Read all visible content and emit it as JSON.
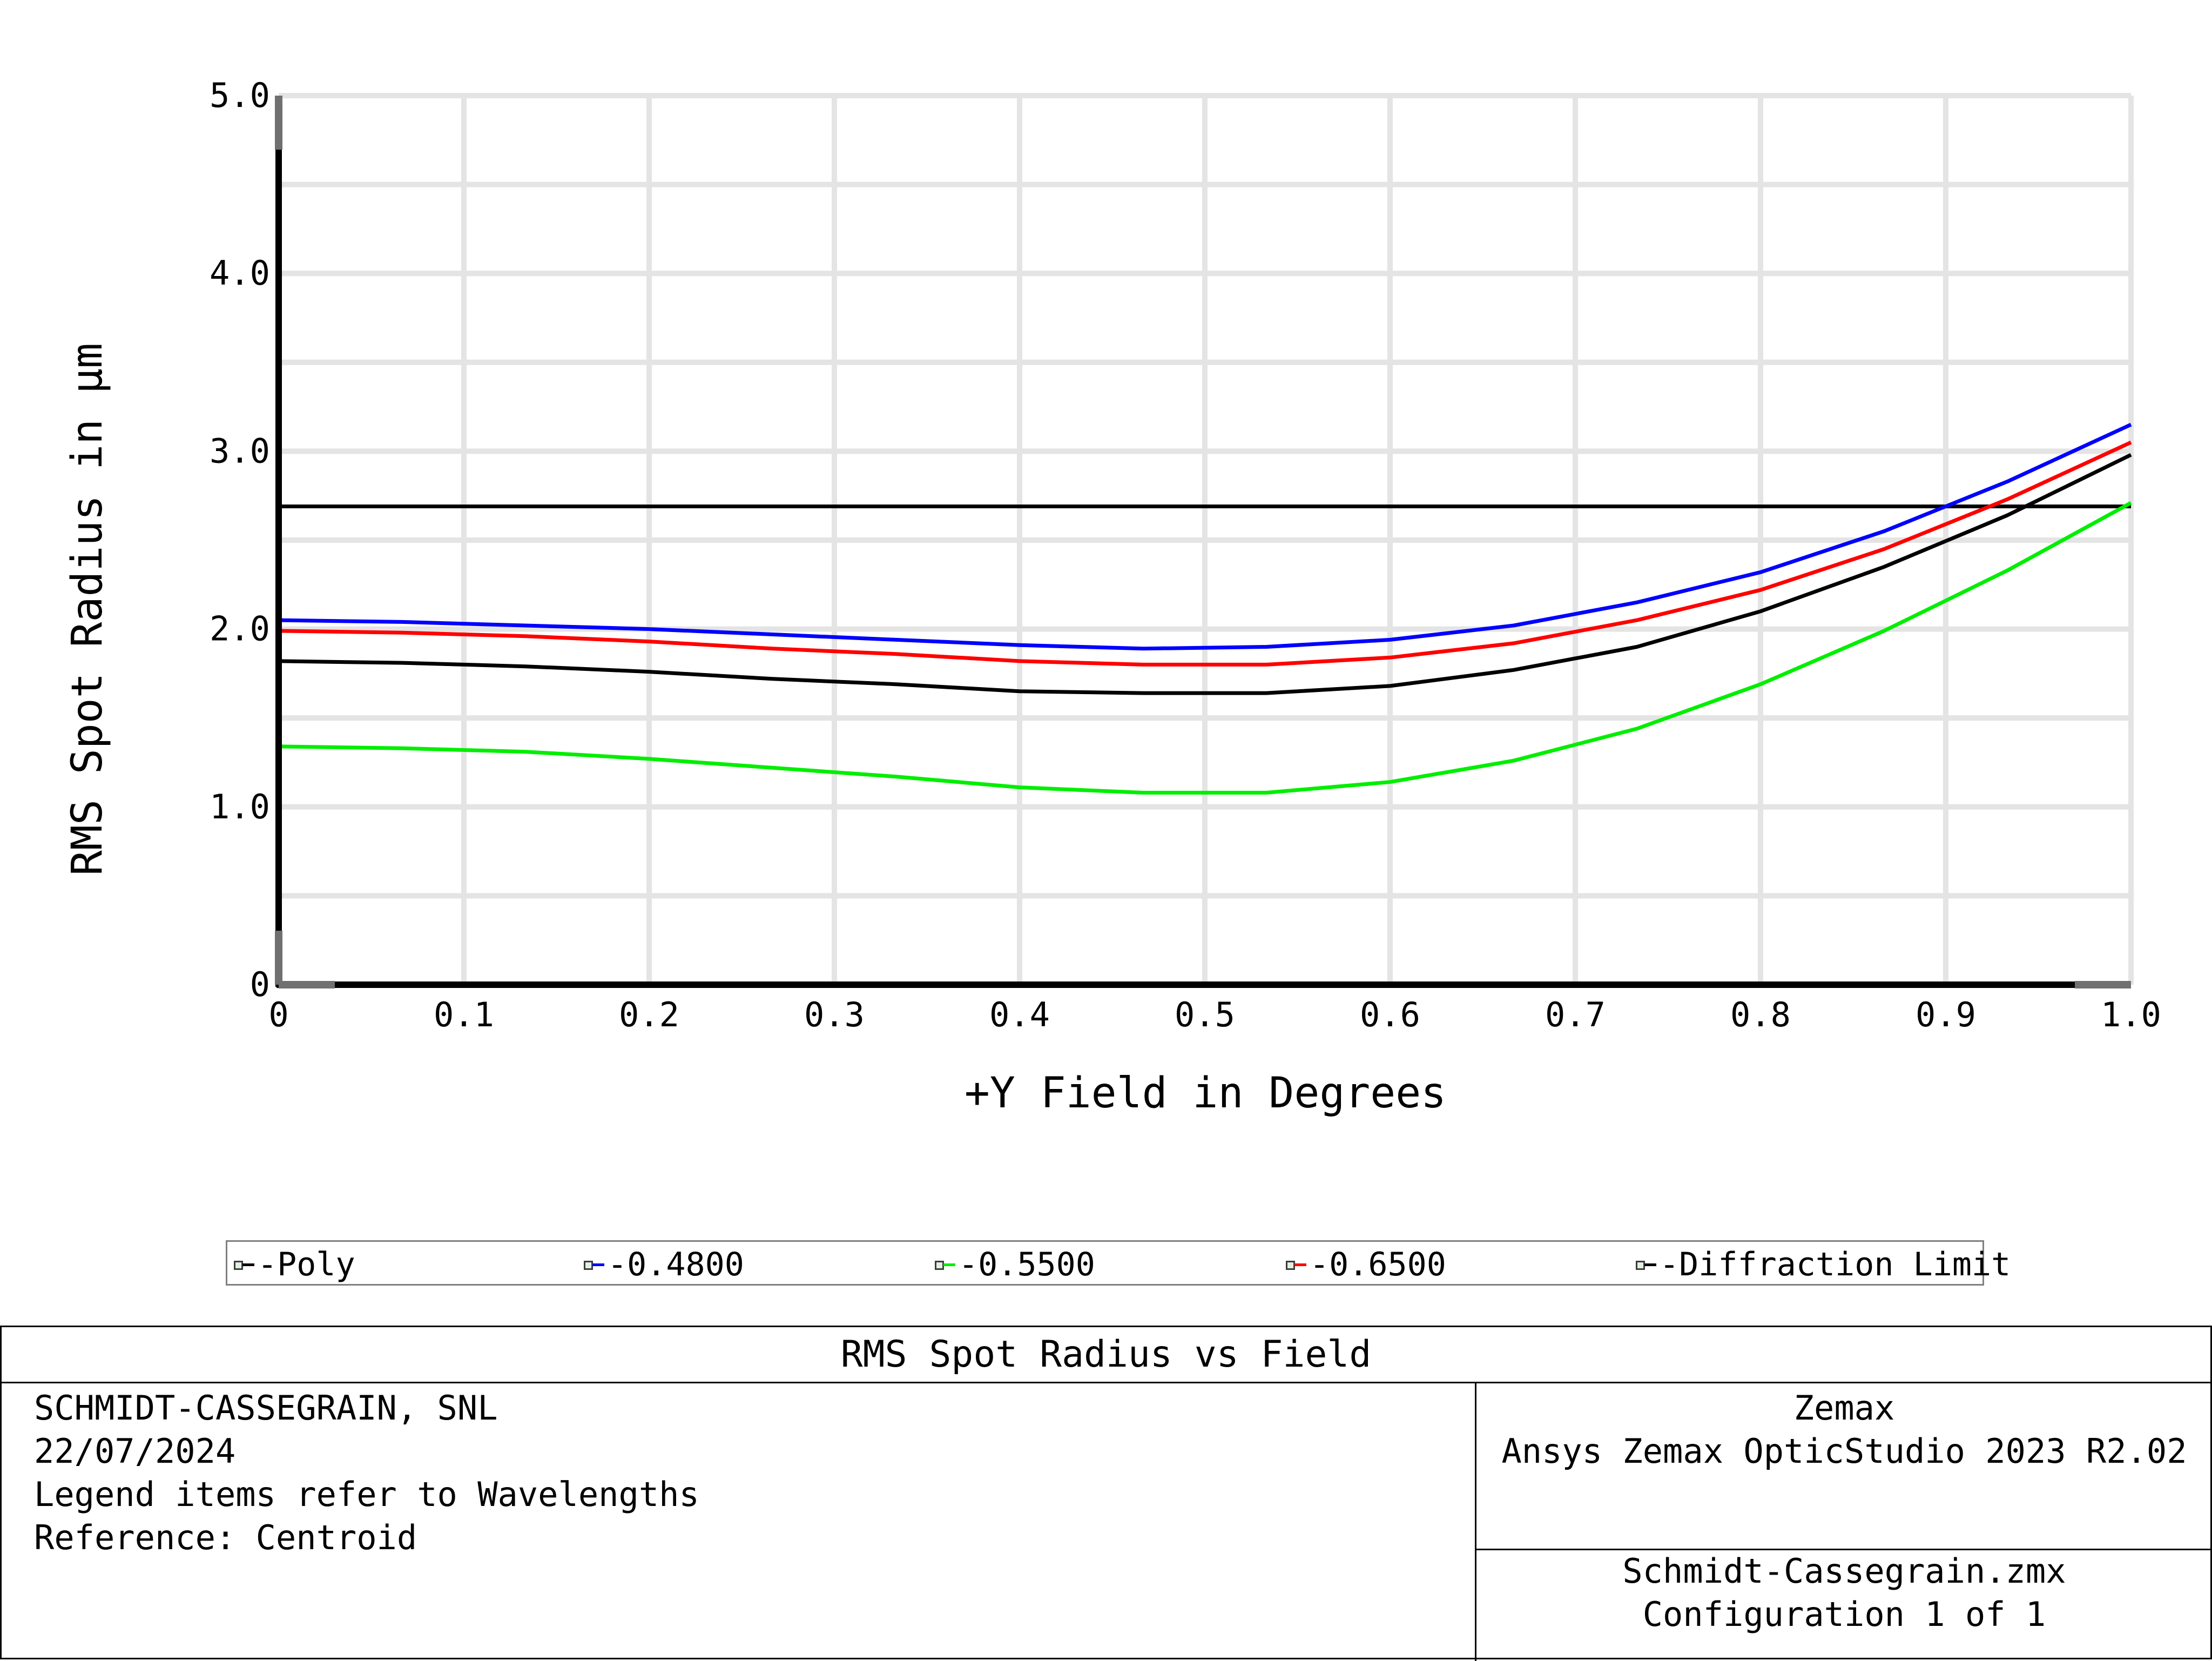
{
  "chart_data": {
    "type": "line",
    "xlabel": "+Y Field in Degrees",
    "ylabel": "RMS Spot Radius in µm",
    "xlim": [
      0,
      1.0
    ],
    "ylim": [
      0,
      5.0
    ],
    "x_ticks": [
      0,
      0.1,
      0.2,
      0.3,
      0.4,
      0.5,
      0.6,
      0.7,
      0.8,
      0.9,
      1.0
    ],
    "x_tick_labels": [
      "0",
      "0.1",
      "0.2",
      "0.3",
      "0.4",
      "0.5",
      "0.6",
      "0.7",
      "0.8",
      "0.9",
      "1.0"
    ],
    "y_ticks": [
      0,
      1.0,
      2.0,
      3.0,
      4.0,
      5.0
    ],
    "y_tick_labels": [
      "0",
      "1.0",
      "2.0",
      "3.0",
      "4.0",
      "5.0"
    ],
    "y_minor_step": 0.5,
    "grid": true,
    "legend_position": "bottom",
    "x": [
      0,
      0.0667,
      0.1333,
      0.2,
      0.2667,
      0.3333,
      0.4,
      0.4667,
      0.5333,
      0.6,
      0.6667,
      0.7333,
      0.8,
      0.8667,
      0.9333,
      1.0
    ],
    "series": [
      {
        "name": "Poly",
        "color": "#000000",
        "values": [
          1.82,
          1.81,
          1.79,
          1.76,
          1.72,
          1.69,
          1.65,
          1.64,
          1.64,
          1.68,
          1.77,
          1.9,
          2.1,
          2.35,
          2.64,
          2.98
        ]
      },
      {
        "name": "0.4800",
        "color": "#0000ff",
        "values": [
          2.05,
          2.04,
          2.02,
          2.0,
          1.97,
          1.94,
          1.91,
          1.89,
          1.9,
          1.94,
          2.02,
          2.15,
          2.32,
          2.55,
          2.83,
          3.15
        ]
      },
      {
        "name": "0.5500",
        "color": "#00ee00",
        "values": [
          1.34,
          1.33,
          1.31,
          1.27,
          1.22,
          1.17,
          1.11,
          1.08,
          1.08,
          1.14,
          1.26,
          1.44,
          1.69,
          1.99,
          2.33,
          2.71
        ]
      },
      {
        "name": "0.6500",
        "color": "#ff0000",
        "values": [
          1.99,
          1.98,
          1.96,
          1.93,
          1.89,
          1.86,
          1.82,
          1.8,
          1.8,
          1.84,
          1.92,
          2.05,
          2.22,
          2.45,
          2.73,
          3.05
        ]
      },
      {
        "name": "Diffraction Limit",
        "color": "#000000",
        "values": [
          2.69,
          2.69,
          2.69,
          2.69,
          2.69,
          2.69,
          2.69,
          2.69,
          2.69,
          2.69,
          2.69,
          2.69,
          2.69,
          2.69,
          2.69,
          2.69
        ]
      }
    ]
  },
  "legend": [
    {
      "label": "-Poly",
      "color": "#000000"
    },
    {
      "label": "-0.4800",
      "color": "#0000ff"
    },
    {
      "label": "-0.5500",
      "color": "#00ee00"
    },
    {
      "label": "-0.6500",
      "color": "#ff0000"
    },
    {
      "label": "-Diffraction Limit",
      "color": "#000000"
    }
  ],
  "info": {
    "title": "RMS Spot Radius vs Field",
    "left_lines": [
      "SCHMIDT-CASSEGRAIN, SNL",
      "22/07/2024",
      "Legend items refer to Wavelengths",
      "Reference: Centroid"
    ],
    "right_top_lines": [
      "Zemax",
      "Ansys Zemax OpticStudio 2023 R2.02"
    ],
    "right_bottom_lines": [
      "Schmidt-Cassegrain.zmx",
      "Configuration 1 of 1"
    ]
  }
}
